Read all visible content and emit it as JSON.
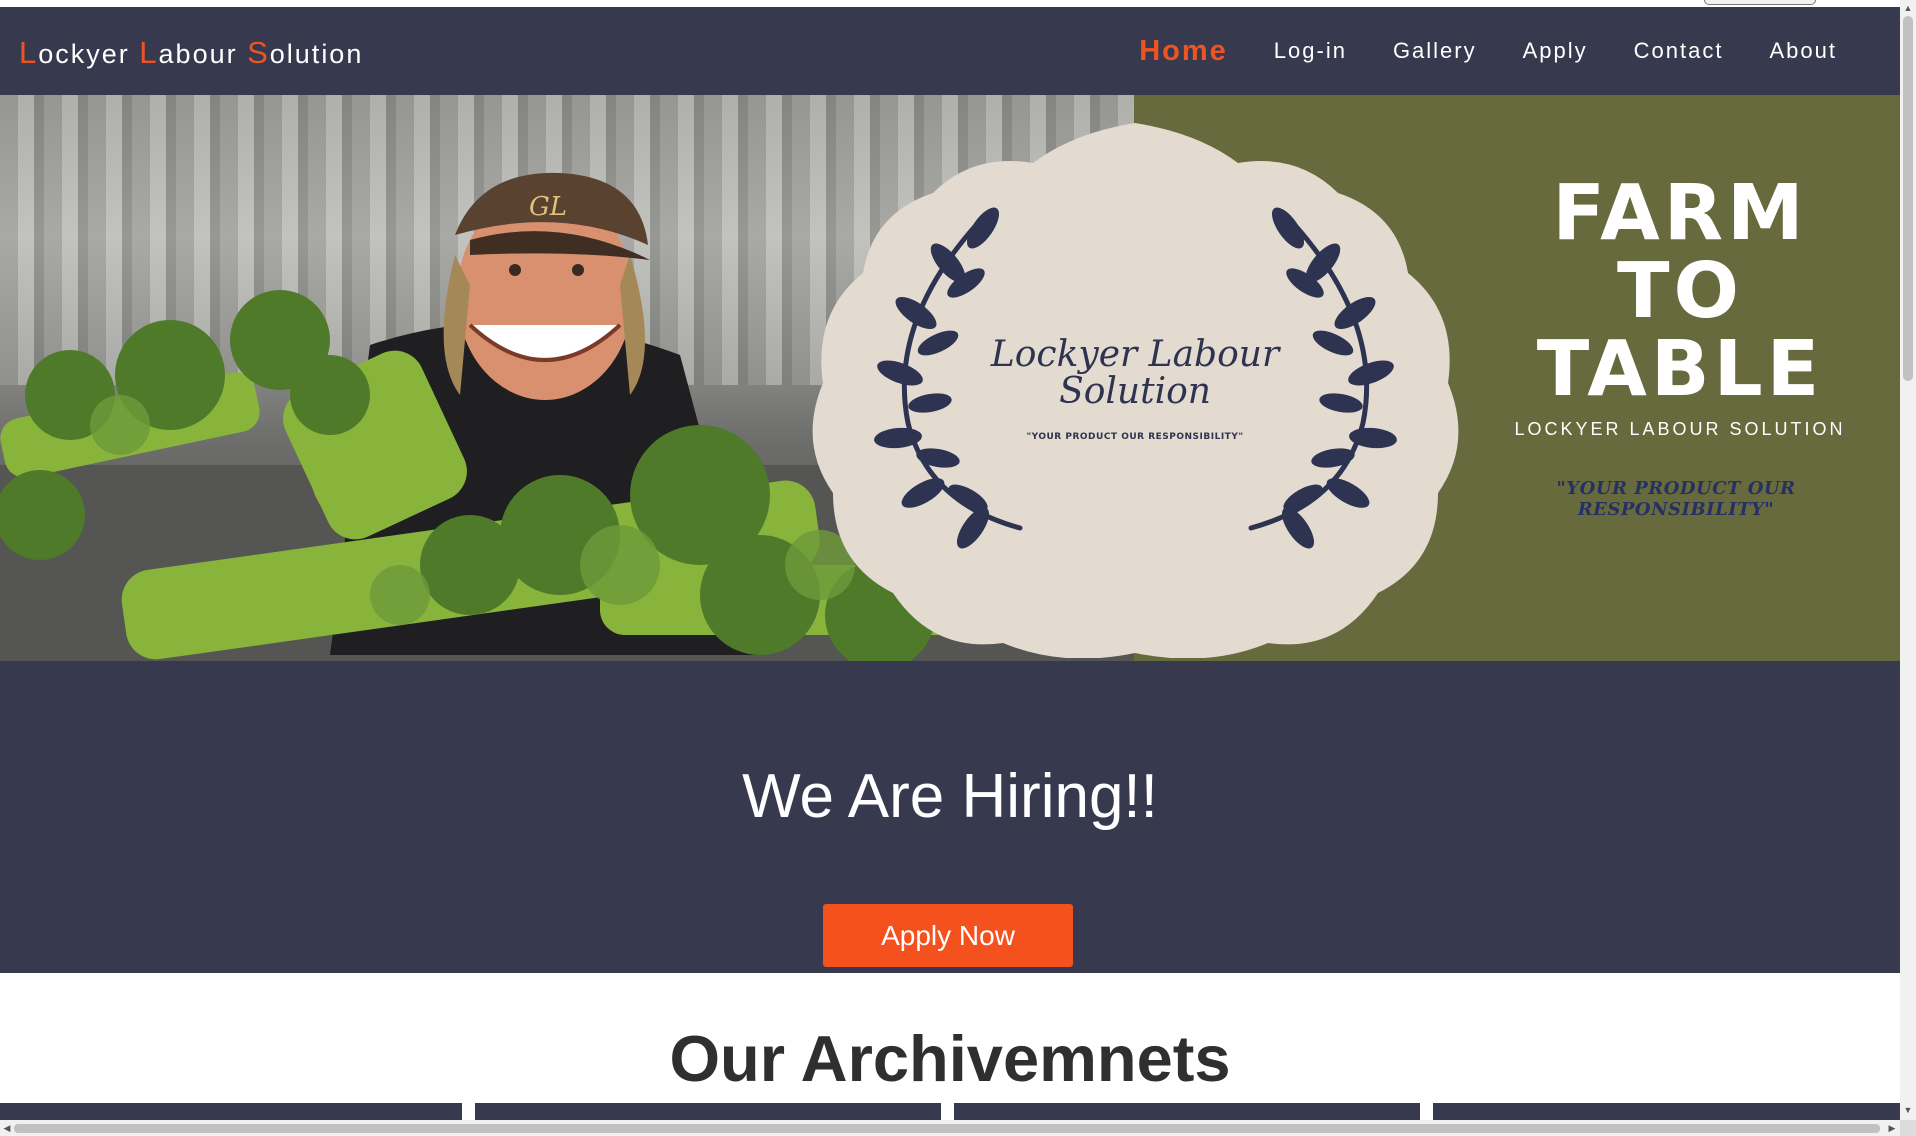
{
  "navbar": {
    "brand": [
      {
        "cap": "L",
        "rest": "ockyer "
      },
      {
        "cap": "L",
        "rest": "abour "
      },
      {
        "cap": "S",
        "rest": "olution"
      }
    ],
    "links": [
      "Home",
      "Log-in",
      "Gallery",
      "Apply",
      "Contact",
      "About"
    ],
    "active": "Home"
  },
  "hero": {
    "badge_title_line1": "Lockyer Labour",
    "badge_title_line2": "Solution",
    "badge_tagline": "\"YOUR PRODUCT OUR RESPONSIBILITY\"",
    "title_lines": [
      "FARM",
      "TO",
      "TABLE"
    ],
    "subtitle": "LOCKYER LABOUR SOLUTION",
    "tagline": "\"YOUR PRODUCT OUR RESPONSIBILITY\"",
    "cap_text": "GL"
  },
  "hiring": {
    "heading": "We Are Hiring!!",
    "button": "Apply Now"
  },
  "achievements": {
    "heading": "Our Archivemnets"
  },
  "colors": {
    "nav_bg": "#373a4e",
    "accent": "#ee5423",
    "button": "#f5511e",
    "olive": "#676a3c",
    "badge": "#e3dbd0",
    "laurel": "#2d3350"
  },
  "icons": [
    "laurel-left-icon",
    "laurel-right-icon",
    "scroll-up-icon",
    "scroll-down-icon",
    "scroll-left-icon",
    "scroll-right-icon"
  ]
}
